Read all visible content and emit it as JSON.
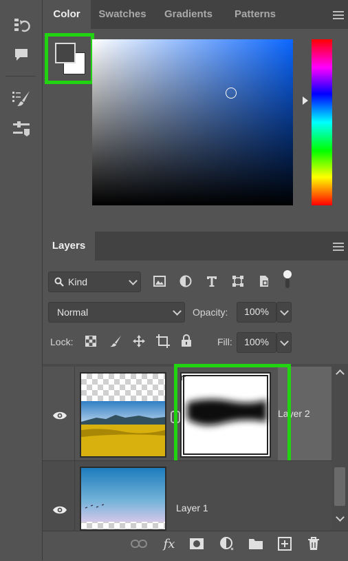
{
  "colors": {
    "highlight": "#22d311",
    "panel": "#535353",
    "tabbar": "#424242"
  },
  "tool_strip": {
    "icons": [
      "history-icon",
      "comment-icon",
      "brush-settings-icon",
      "adjustment-sliders-icon"
    ]
  },
  "color_panel": {
    "tabs": [
      "Color",
      "Swatches",
      "Gradients",
      "Patterns"
    ],
    "active_tab": "Color",
    "foreground_color": "#454545",
    "background_color": "#ffffff",
    "picker_hue": "#0a66ff"
  },
  "layers_panel": {
    "tab_label": "Layers",
    "filter": {
      "label": "Kind"
    },
    "blend_mode": "Normal",
    "opacity_label": "Opacity:",
    "opacity_value": "100%",
    "lock_label": "Lock:",
    "fill_label": "Fill:",
    "fill_value": "100%",
    "layers": [
      {
        "name": "Layer 2",
        "visible": true,
        "has_mask": true,
        "selected": true
      },
      {
        "name": "Layer 1",
        "visible": true,
        "has_mask": false,
        "selected": false
      }
    ],
    "bottom_icons": [
      "link-icon",
      "fx-icon",
      "add-mask-icon",
      "adjustment-layer-icon",
      "group-folder-icon",
      "new-layer-icon",
      "trash-icon"
    ],
    "fx_label": "fx"
  }
}
